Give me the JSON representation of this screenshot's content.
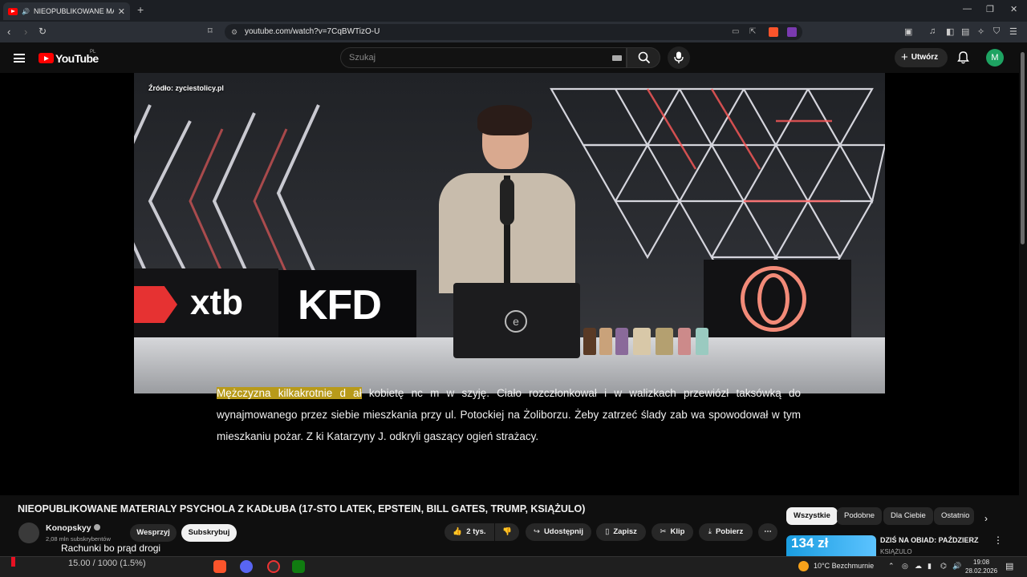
{
  "browser": {
    "tab_title": "NIEOPUBLIKOWANE MATERIAŁ",
    "url": "youtube.com/watch?v=7CqBWTizO-U"
  },
  "masthead": {
    "logo_text": "YouTube",
    "country_code": "PL",
    "search_placeholder": "Szukaj",
    "create_label": "Utwórz",
    "avatar_letter": "M"
  },
  "video": {
    "source_label": "Źródło: zyciestolicy.pl",
    "brands": [
      "xtb",
      "KFD"
    ],
    "caption_highlight": "Mężczyzna kilkakrotnie d    ał",
    "caption_rest": " kobietę nc    m w szyję. Ciało rozczłonkował i w walizkach przewiózł taksówką do wynajmowanego przez siebie mieszkania przy ul. Potockiej na Żoliborzu. Żeby zatrzeć ślady zab      wa spowodował w tym mieszkaniu pożar. Z      ki Katarzyny J. odkryli gaszący ogień strażacy."
  },
  "watch": {
    "title": "NIEOPUBLIKOWANE MATERIALY PSYCHOLA Z KADŁUBA (17-STO LATEK, EPSTEIN, BILL GATES, TRUMP, KSIĄŻULO)",
    "channel_name": "Konopskyy",
    "channel_subs": "2,08 mln subskrybentów",
    "support_label": "Wesprzyj",
    "subscribe_label": "Subskrybuj",
    "like_count": "2 tys.",
    "share_label": "Udostępnij",
    "save_label": "Zapisz",
    "clip_label": "Klip",
    "download_label": "Pobierz"
  },
  "sidebar": {
    "chips": [
      "Wszystkie",
      "Podobne",
      "Dla Ciebie",
      "Ostatnio"
    ],
    "rec_title": "DZIŚ NA OBIAD: PAŹDZIERZ",
    "rec_channel": "KSIĄŻULO",
    "rec_thumb_text": "134 zł"
  },
  "overlay": {
    "text": "Rachunki bo prąd drogi",
    "progress": "15.00 / 1000 (1.5%)"
  },
  "taskbar": {
    "weather": "10°C  Bezchmurnie",
    "time": "19:08",
    "date": "28.02.2026"
  }
}
